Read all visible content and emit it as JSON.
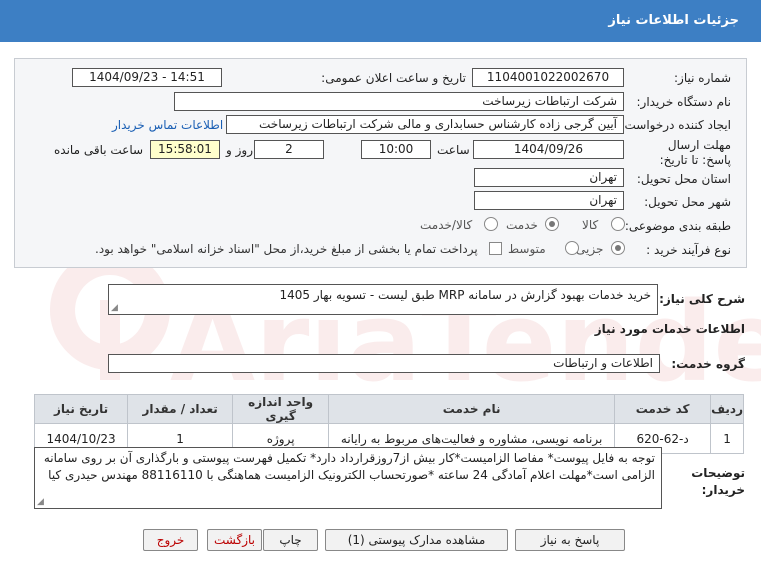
{
  "header": {
    "title": "جزئیات اطلاعات نیاز"
  },
  "fields": {
    "need_number_label": "شماره نیاز:",
    "need_number": "1104001022002670",
    "announce_label": "تاریخ و ساعت اعلان عمومی:",
    "announce_value": "1404/09/23 - 14:51",
    "buyer_org_label": "نام دستگاه خریدار:",
    "buyer_org": "شرکت ارتباطات زیرساخت",
    "creator_label": "ایجاد کننده درخواست:",
    "creator": "آیین گرجی زاده کارشناس حسابداری و مالی شرکت ارتباطات زیرساخت",
    "contact_link": "اطلاعات تماس خریدار",
    "deadline_label": "مهلت ارسال پاسخ: تا تاریخ:",
    "deadline_date": "1404/09/26",
    "time_label": "ساعت",
    "deadline_time": "10:00",
    "days": "2",
    "days_label": "روز و",
    "remaining": "15:58:01",
    "remaining_label": "ساعت باقی مانده",
    "province_label": "استان محل تحویل:",
    "province": "تهران",
    "city_label": "شهر محل تحویل:",
    "city": "تهران",
    "category_label": "طبقه بندی موضوعی:",
    "category_options": [
      "کالا",
      "خدمت",
      "کالا/خدمت"
    ],
    "process_label": "نوع فرآیند خرید :",
    "process_options": [
      "جزیی",
      "متوسط"
    ],
    "payment_note": "پرداخت تمام یا بخشی از مبلغ خرید،از محل \"اسناد خزانه اسلامی\" خواهد بود."
  },
  "summary": {
    "label": "شرح کلی نیاز:",
    "text": "خرید خدمات بهبود گزارش در سامانه MRP طبق لیست -     تسویه بهار 1405"
  },
  "services": {
    "section_title": "اطلاعات خدمات مورد نیاز",
    "group_label": "گروه خدمت:",
    "group": "اطلاعات و ارتباطات",
    "columns": [
      "ردیف",
      "کد خدمت",
      "نام خدمت",
      "واحد اندازه گیری",
      "تعداد / مقدار",
      "تاریخ نیاز"
    ],
    "rows": [
      {
        "row": "1",
        "code": "د-62-620",
        "name": "برنامه نویسی، مشاوره و فعالیت‌های مربوط به رایانه",
        "unit": "پروژه",
        "qty": "1",
        "date": "1404/10/23"
      }
    ]
  },
  "buyer_notes": {
    "label": "توضیحات خریدار:",
    "text": "توجه به فایل پیوست* مفاصا الزامیست*کار بیش از7روزقرارداد دارد* تکمیل فهرست پیوستی و بارگذاری آن بر روی سامانه الزامی است*مهلت اعلام آمادگی 24 ساعته *صورتحساب الکترونیک الزامیست هماهنگی با 88116110 مهندس حیدری کیا"
  },
  "buttons": {
    "reply": "پاسخ به نیاز",
    "attachments": "مشاهده مدارک پیوستی (1)",
    "print": "چاپ",
    "back": "بازگشت",
    "exit": "خروج"
  },
  "colors": {
    "header_bg": "#3d7fc4",
    "remaining_bg": "#ffffcc",
    "link": "#1a5fb4",
    "danger": "#b00000"
  }
}
